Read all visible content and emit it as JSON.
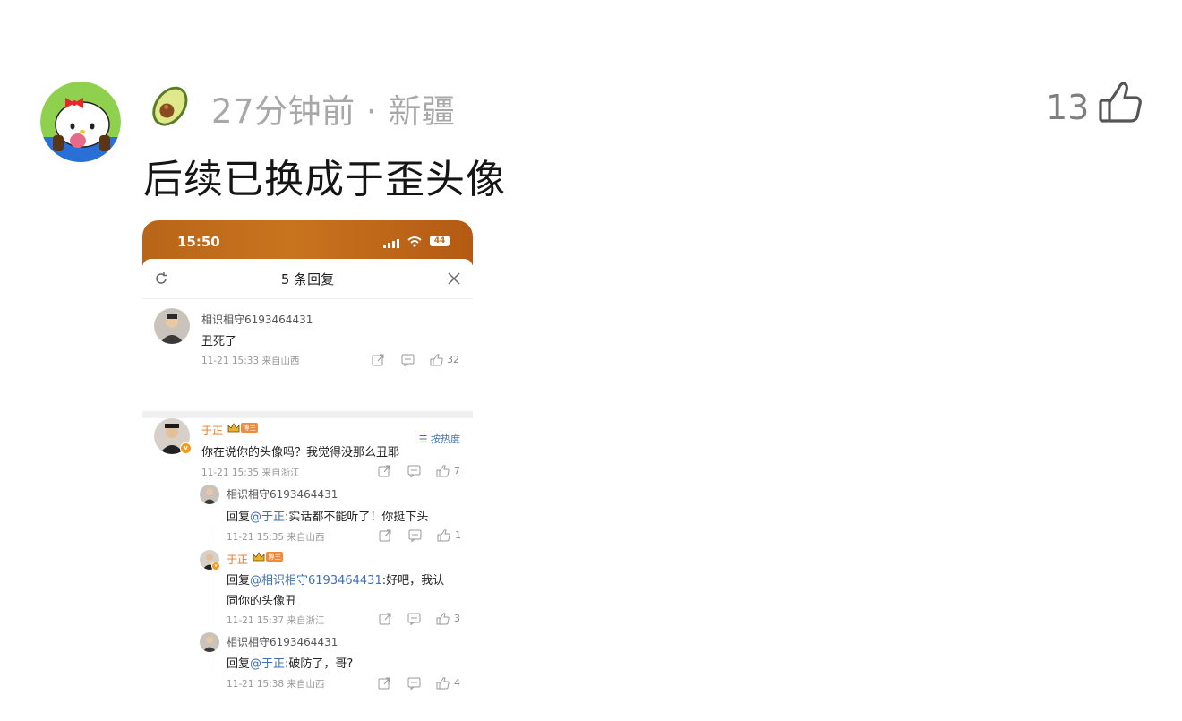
{
  "comment": {
    "time_location": "27分钟前 · 新疆",
    "text": "后续已换成于歪头像",
    "likes": "13"
  },
  "screenshot": {
    "status_time": "15:50",
    "battery": "44",
    "sheet_title": "5 条回复",
    "sort_label": "按热度",
    "root": {
      "user": "相识相守6193464431",
      "text": "丑死了",
      "meta": "11-21 15:33  来自山西",
      "likes": "32"
    },
    "replies": [
      {
        "user": "于正",
        "tag": "博主",
        "text": "你在说你的头像吗？我觉得没那么丑耶",
        "meta": "11-21 15:35  来自浙江",
        "likes": "7"
      },
      {
        "user": "相识相守6193464431",
        "prefix": "回复",
        "mention": "@于正",
        "text": ":实话都不能听了！你挺下头",
        "meta": "11-21 15:35  来自山西",
        "likes": "1"
      },
      {
        "user": "于正",
        "tag": "博主",
        "prefix": "回复",
        "mention": "@相识相守6193464431",
        "text": ":好吧，我认",
        "text2": "同你的头像丑",
        "meta": "11-21 15:37  来自浙江",
        "likes": "3"
      },
      {
        "user": "相识相守6193464431",
        "prefix": "回复",
        "mention": "@于正",
        "text": ":破防了，哥?",
        "meta": "11-21 15:38  来自山西",
        "likes": "4"
      }
    ]
  },
  "colors": {
    "accent_link": "#3f6fb0",
    "blogger_orange": "#e6782a",
    "status_bar": "#c36d1c"
  }
}
